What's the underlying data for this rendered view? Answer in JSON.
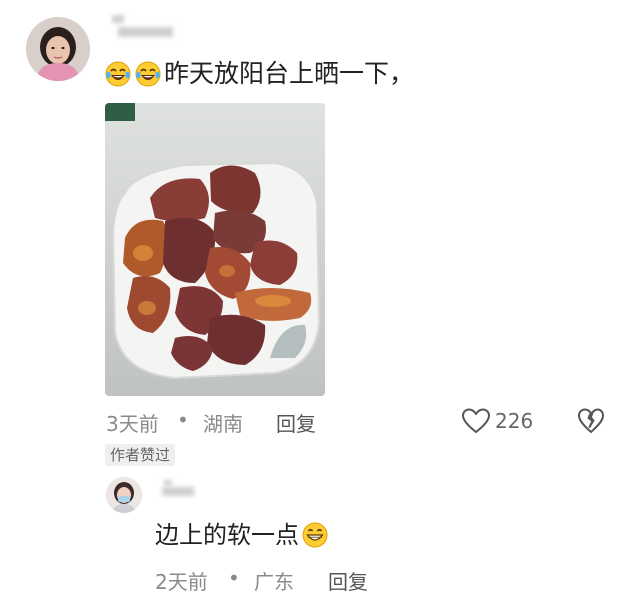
{
  "comment": {
    "text": "昨天放阳台上晒一下，",
    "time": "3天前",
    "separator": "•",
    "location": "湖南",
    "reply_label": "回复",
    "like_count": "226",
    "author_badge": "作者赞过",
    "emoji_icon": "laughing-tears-emoji-icon"
  },
  "reply": {
    "text": "边上的软一点",
    "time": "2天前",
    "separator": "•",
    "location": "广东",
    "reply_label": "回复",
    "emoji_icon": "grinning-face-emoji-icon"
  },
  "colors": {
    "meta_gray": "#8a8a8a",
    "persimmon": "#7a3a33",
    "plate": "#f3f3f2"
  }
}
